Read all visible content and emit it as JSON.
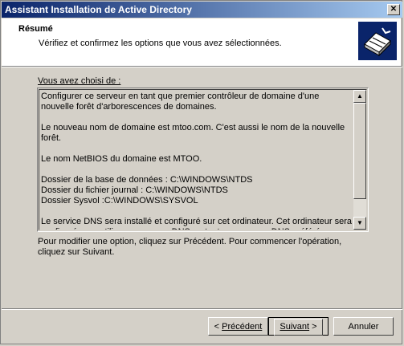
{
  "window": {
    "title": "Assistant Installation de Active Directory",
    "close_glyph": "✕"
  },
  "header": {
    "title": "Résumé",
    "subtitle": "Vérifiez et confirmez les options que vous avez sélectionnées.",
    "icon": "active-directory-book-icon"
  },
  "summary": {
    "label": "Vous avez choisi de :",
    "text": "Configurer ce serveur en tant que premier contrôleur de domaine d'une nouvelle forêt d'arborescences de domaines.\n\nLe nouveau nom de domaine est mtoo.com. C'est aussi le nom de la nouvelle forêt.\n\nLe nom NetBIOS du domaine est MTOO.\n\nDossier de la base de données : C:\\WINDOWS\\NTDS\nDossier du fichier journal : C:\\WINDOWS\\NTDS\nDossier Sysvol :C:\\WINDOWS\\SYSVOL\n\nLe service DNS sera installé et configuré sur cet ordinateur. Cet ordinateur sera configuré pour utiliser ce serveur DNS en tant que serveur DNS préféré.",
    "scroll_up_glyph": "▲",
    "scroll_down_glyph": "▼"
  },
  "instructions": "Pour modifier une option, cliquez sur Précédent. Pour commencer l'opération, cliquez sur Suivant.",
  "buttons": {
    "back_prefix": "< ",
    "back_label": "Précédent",
    "next_label": "Suivant",
    "next_suffix": " >",
    "cancel_label": "Annuler"
  }
}
